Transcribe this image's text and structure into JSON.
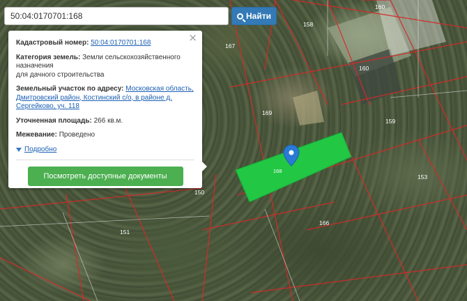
{
  "search": {
    "value": "50:04:0170701:168",
    "button_label": "Найти",
    "button_icon": "search-icon"
  },
  "popup": {
    "close_symbol": "×",
    "cadastral_label": "Кадастровый номер:",
    "cadastral_value": "50:04:0170701:168",
    "category_label": "Категория земель:",
    "category_value_1": "Земли сельскохозяйственного",
    "category_value_2": "назначения",
    "category_value_3": "для дачного строительства",
    "address_label": "Земельный участок по адресу:",
    "address_value_1": "Московская область,",
    "address_value_2": "Дмитровский район, Костинский с/о, в районе д.",
    "address_value_3": "Сергейково, уч. 118",
    "area_label": "Уточненная площадь:",
    "area_value": "266 кв.м.",
    "survey_label": "Межевание:",
    "survey_value": "Проведено",
    "details_link": "Подробно",
    "docs_button": "Посмотреть доступные документы"
  },
  "map": {
    "parcel_labels": {
      "p160a": "160",
      "p158": "158",
      "p167": "167",
      "p160b": "160",
      "p169": "169",
      "p159": "159",
      "p168": "168",
      "p153": "153",
      "p150": "150",
      "p166": "166",
      "p151": "151"
    },
    "highlight_color": "#22c744",
    "boundary_color": "#d42a2a"
  }
}
